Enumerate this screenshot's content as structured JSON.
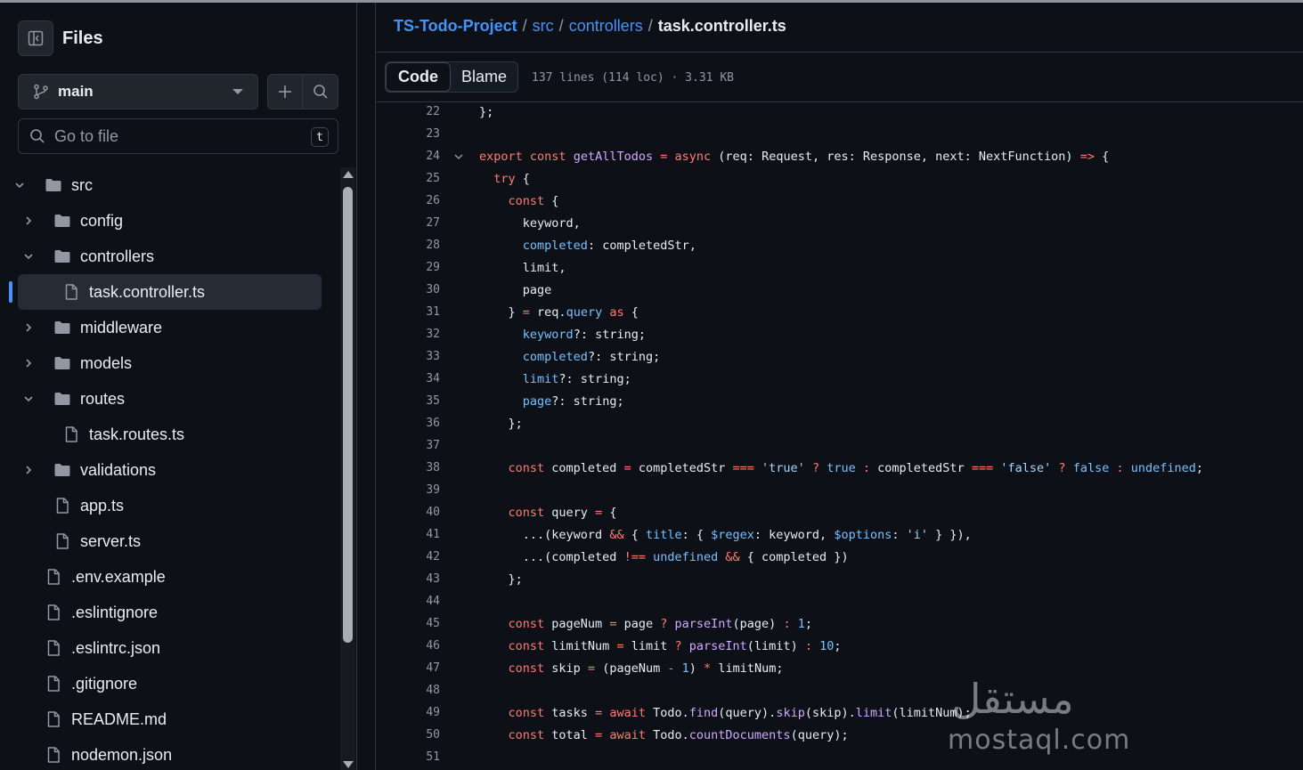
{
  "sidebar": {
    "title": "Files",
    "branch": "main",
    "search_placeholder": "Go to file",
    "search_shortcut": "t",
    "tree": [
      {
        "label": "src",
        "type": "folder",
        "expanded": true,
        "depth": 0
      },
      {
        "label": "config",
        "type": "folder",
        "expanded": false,
        "depth": 1
      },
      {
        "label": "controllers",
        "type": "folder",
        "expanded": true,
        "depth": 1
      },
      {
        "label": "task.controller.ts",
        "type": "file",
        "depth": 2,
        "selected": true
      },
      {
        "label": "middleware",
        "type": "folder",
        "expanded": false,
        "depth": 1
      },
      {
        "label": "models",
        "type": "folder",
        "expanded": false,
        "depth": 1
      },
      {
        "label": "routes",
        "type": "folder",
        "expanded": true,
        "depth": 1
      },
      {
        "label": "task.routes.ts",
        "type": "file",
        "depth": 2
      },
      {
        "label": "validations",
        "type": "folder",
        "expanded": false,
        "depth": 1
      },
      {
        "label": "app.ts",
        "type": "file",
        "depth": 1
      },
      {
        "label": "server.ts",
        "type": "file",
        "depth": 1
      },
      {
        "label": ".env.example",
        "type": "file",
        "depth": 0
      },
      {
        "label": ".eslintignore",
        "type": "file",
        "depth": 0
      },
      {
        "label": ".eslintrc.json",
        "type": "file",
        "depth": 0
      },
      {
        "label": ".gitignore",
        "type": "file",
        "depth": 0
      },
      {
        "label": "README.md",
        "type": "file",
        "depth": 0
      },
      {
        "label": "nodemon.json",
        "type": "file",
        "depth": 0
      }
    ]
  },
  "breadcrumb": {
    "repo": "TS-Todo-Project",
    "dirs": [
      "src",
      "controllers"
    ],
    "file": "task.controller.ts"
  },
  "toolbar": {
    "code_tab": "Code",
    "blame_tab": "Blame",
    "meta": "137 lines (114 loc) · 3.31 KB"
  },
  "code": {
    "lines": [
      {
        "n": "22",
        "t": [
          [
            "",
            "};"
          ]
        ]
      },
      {
        "n": "23",
        "t": []
      },
      {
        "n": "24",
        "fold": true,
        "t": [
          [
            "k",
            "export"
          ],
          [
            "",
            " "
          ],
          [
            "k",
            "const"
          ],
          [
            "",
            " "
          ],
          [
            "f",
            "getAllTodos"
          ],
          [
            "",
            " "
          ],
          [
            "k",
            "="
          ],
          [
            "",
            " "
          ],
          [
            "k",
            "async"
          ],
          [
            "",
            " (req: Request, res: Response, next: NextFunction) "
          ],
          [
            "k",
            "=>"
          ],
          [
            "",
            " {"
          ]
        ]
      },
      {
        "n": "25",
        "t": [
          [
            "",
            "  "
          ],
          [
            "k",
            "try"
          ],
          [
            "",
            " {"
          ]
        ]
      },
      {
        "n": "26",
        "t": [
          [
            "",
            "    "
          ],
          [
            "k",
            "const"
          ],
          [
            "",
            " {"
          ]
        ]
      },
      {
        "n": "27",
        "t": [
          [
            "",
            "      keyword,"
          ]
        ]
      },
      {
        "n": "28",
        "t": [
          [
            "",
            "      "
          ],
          [
            "c",
            "completed"
          ],
          [
            "",
            ": completedStr,"
          ]
        ]
      },
      {
        "n": "29",
        "t": [
          [
            "",
            "      limit,"
          ]
        ]
      },
      {
        "n": "30",
        "t": [
          [
            "",
            "      page"
          ]
        ]
      },
      {
        "n": "31",
        "t": [
          [
            "",
            "    } "
          ],
          [
            "k",
            "="
          ],
          [
            "",
            " req."
          ],
          [
            "c",
            "query"
          ],
          [
            "",
            " "
          ],
          [
            "k",
            "as"
          ],
          [
            "",
            " {"
          ]
        ]
      },
      {
        "n": "32",
        "t": [
          [
            "",
            "      "
          ],
          [
            "c",
            "keyword"
          ],
          [
            "",
            "?: string;"
          ]
        ]
      },
      {
        "n": "33",
        "t": [
          [
            "",
            "      "
          ],
          [
            "c",
            "completed"
          ],
          [
            "",
            "?: string;"
          ]
        ]
      },
      {
        "n": "34",
        "t": [
          [
            "",
            "      "
          ],
          [
            "c",
            "limit"
          ],
          [
            "",
            "?: string;"
          ]
        ]
      },
      {
        "n": "35",
        "t": [
          [
            "",
            "      "
          ],
          [
            "c",
            "page"
          ],
          [
            "",
            "?: string;"
          ]
        ]
      },
      {
        "n": "36",
        "t": [
          [
            "",
            "    };"
          ]
        ]
      },
      {
        "n": "37",
        "t": []
      },
      {
        "n": "38",
        "t": [
          [
            "",
            "    "
          ],
          [
            "k",
            "const"
          ],
          [
            "",
            " completed "
          ],
          [
            "k",
            "="
          ],
          [
            "",
            " completedStr "
          ],
          [
            "k",
            "==="
          ],
          [
            "",
            " "
          ],
          [
            "s",
            "'true'"
          ],
          [
            "",
            " "
          ],
          [
            "k",
            "?"
          ],
          [
            "",
            " "
          ],
          [
            "c",
            "true"
          ],
          [
            "",
            " "
          ],
          [
            "k",
            ":"
          ],
          [
            "",
            " completedStr "
          ],
          [
            "k",
            "==="
          ],
          [
            "",
            " "
          ],
          [
            "s",
            "'false'"
          ],
          [
            "",
            " "
          ],
          [
            "k",
            "?"
          ],
          [
            "",
            " "
          ],
          [
            "c",
            "false"
          ],
          [
            "",
            " "
          ],
          [
            "k",
            ":"
          ],
          [
            "",
            " "
          ],
          [
            "c",
            "undefined"
          ],
          [
            "",
            ";"
          ]
        ]
      },
      {
        "n": "39",
        "t": []
      },
      {
        "n": "40",
        "t": [
          [
            "",
            "    "
          ],
          [
            "k",
            "const"
          ],
          [
            "",
            " query "
          ],
          [
            "k",
            "="
          ],
          [
            "",
            " {"
          ]
        ]
      },
      {
        "n": "41",
        "t": [
          [
            "",
            "      ...(keyword "
          ],
          [
            "k",
            "&&"
          ],
          [
            "",
            " { "
          ],
          [
            "c",
            "title"
          ],
          [
            "",
            ": { "
          ],
          [
            "c",
            "$regex"
          ],
          [
            "",
            ": keyword, "
          ],
          [
            "c",
            "$options"
          ],
          [
            "",
            ": "
          ],
          [
            "s",
            "'i'"
          ],
          [
            "",
            " } }),"
          ]
        ]
      },
      {
        "n": "42",
        "t": [
          [
            "",
            "      ...(completed "
          ],
          [
            "k",
            "!=="
          ],
          [
            "",
            " "
          ],
          [
            "c",
            "undefined"
          ],
          [
            "",
            " "
          ],
          [
            "k",
            "&&"
          ],
          [
            "",
            " { completed })"
          ]
        ]
      },
      {
        "n": "43",
        "t": [
          [
            "",
            "    };"
          ]
        ]
      },
      {
        "n": "44",
        "t": []
      },
      {
        "n": "45",
        "t": [
          [
            "",
            "    "
          ],
          [
            "k",
            "const"
          ],
          [
            "",
            " pageNum "
          ],
          [
            "k",
            "="
          ],
          [
            "",
            " page "
          ],
          [
            "k",
            "?"
          ],
          [
            "",
            " "
          ],
          [
            "f",
            "parseInt"
          ],
          [
            "",
            "(page) "
          ],
          [
            "k",
            ":"
          ],
          [
            "",
            " "
          ],
          [
            "c",
            "1"
          ],
          [
            "",
            ";"
          ]
        ]
      },
      {
        "n": "46",
        "t": [
          [
            "",
            "    "
          ],
          [
            "k",
            "const"
          ],
          [
            "",
            " limitNum "
          ],
          [
            "k",
            "="
          ],
          [
            "",
            " limit "
          ],
          [
            "k",
            "?"
          ],
          [
            "",
            " "
          ],
          [
            "f",
            "parseInt"
          ],
          [
            "",
            "(limit) "
          ],
          [
            "k",
            ":"
          ],
          [
            "",
            " "
          ],
          [
            "c",
            "10"
          ],
          [
            "",
            ";"
          ]
        ]
      },
      {
        "n": "47",
        "t": [
          [
            "",
            "    "
          ],
          [
            "k",
            "const"
          ],
          [
            "",
            " skip "
          ],
          [
            "k",
            "="
          ],
          [
            "",
            " (pageNum "
          ],
          [
            "k",
            "-"
          ],
          [
            "",
            " "
          ],
          [
            "c",
            "1"
          ],
          [
            "",
            ") "
          ],
          [
            "k",
            "*"
          ],
          [
            "",
            " limitNum;"
          ]
        ]
      },
      {
        "n": "48",
        "t": []
      },
      {
        "n": "49",
        "t": [
          [
            "",
            "    "
          ],
          [
            "k",
            "const"
          ],
          [
            "",
            " tasks "
          ],
          [
            "k",
            "="
          ],
          [
            "",
            " "
          ],
          [
            "k",
            "await"
          ],
          [
            "",
            " Todo."
          ],
          [
            "f",
            "find"
          ],
          [
            "",
            "(query)."
          ],
          [
            "f",
            "skip"
          ],
          [
            "",
            "(skip)."
          ],
          [
            "f",
            "limit"
          ],
          [
            "",
            "(limitNum);"
          ]
        ]
      },
      {
        "n": "50",
        "t": [
          [
            "",
            "    "
          ],
          [
            "k",
            "const"
          ],
          [
            "",
            " total "
          ],
          [
            "k",
            "="
          ],
          [
            "",
            " "
          ],
          [
            "k",
            "await"
          ],
          [
            "",
            " Todo."
          ],
          [
            "f",
            "countDocuments"
          ],
          [
            "",
            "(query);"
          ]
        ]
      },
      {
        "n": "51",
        "t": []
      }
    ]
  },
  "watermark": {
    "arabic": "مستقل",
    "latin": "mostaql.com"
  },
  "colors": {
    "background": "#0d1117",
    "link": "#4493f8",
    "keyword": "#ff7b72",
    "function": "#d2a8ff",
    "constant": "#79c0ff",
    "string": "#a5d6ff"
  }
}
